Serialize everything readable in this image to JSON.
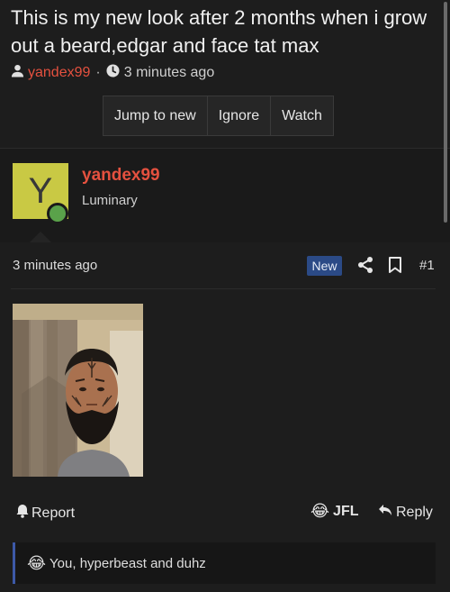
{
  "thread": {
    "title": "This is my new look after 2 months when i grow out a beard,edgar and face tat max",
    "author": "yandex99",
    "separator": "·",
    "time": "3 minutes ago"
  },
  "buttons": {
    "jump": "Jump to new",
    "ignore": "Ignore",
    "watch": "Watch"
  },
  "user": {
    "avatar_letter": "Y",
    "name": "yandex99",
    "title": "Luminary",
    "colors": {
      "avatar": "#c9c944",
      "online": "#5aa24a",
      "name": "#e5513f"
    }
  },
  "post": {
    "date": "3 minutes ago",
    "badge": "New",
    "number": "#1",
    "icons": [
      "share-icon",
      "bookmark-icon"
    ]
  },
  "actions": {
    "report": "Report",
    "jfl_emoji": "😂",
    "jfl": "JFL",
    "reply": "Reply"
  },
  "reactions": {
    "emoji": "😂",
    "text": "You, hyperbeast and duhz"
  }
}
